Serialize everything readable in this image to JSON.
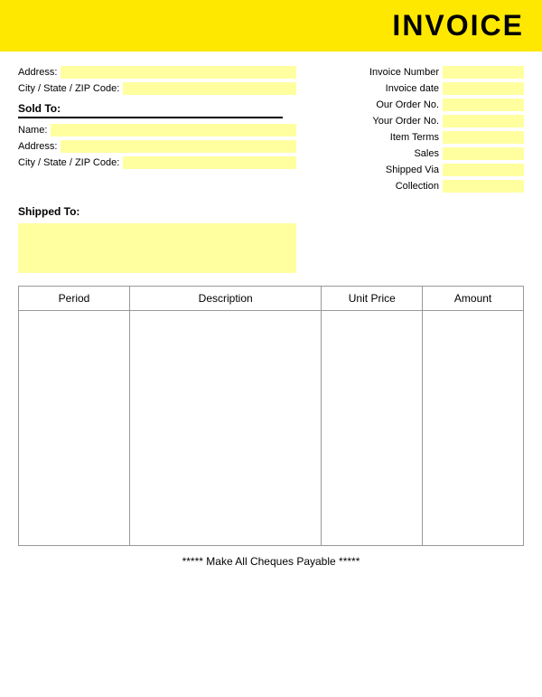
{
  "header": {
    "title": "INVOICE"
  },
  "form": {
    "address_label": "Address:",
    "city_label": "City / State / ZIP Code:",
    "sold_to_label": "Sold To:",
    "name_label": "Name:",
    "address2_label": "Address:",
    "city2_label": "City / State / ZIP Code:",
    "shipped_to_label": "Shipped To:"
  },
  "right_fields": [
    {
      "label": "Invoice Number"
    },
    {
      "label": "Invoice date"
    },
    {
      "label": "Our Order No."
    },
    {
      "label": "Your Order No."
    },
    {
      "label": "Item Terms"
    },
    {
      "label": "Sales"
    },
    {
      "label": "Shipped Via"
    },
    {
      "label": "Collection"
    }
  ],
  "table": {
    "columns": [
      "Period",
      "Description",
      "Unit Price",
      "Amount"
    ]
  },
  "footer": {
    "text": "***** Make All Cheques Payable *****"
  }
}
